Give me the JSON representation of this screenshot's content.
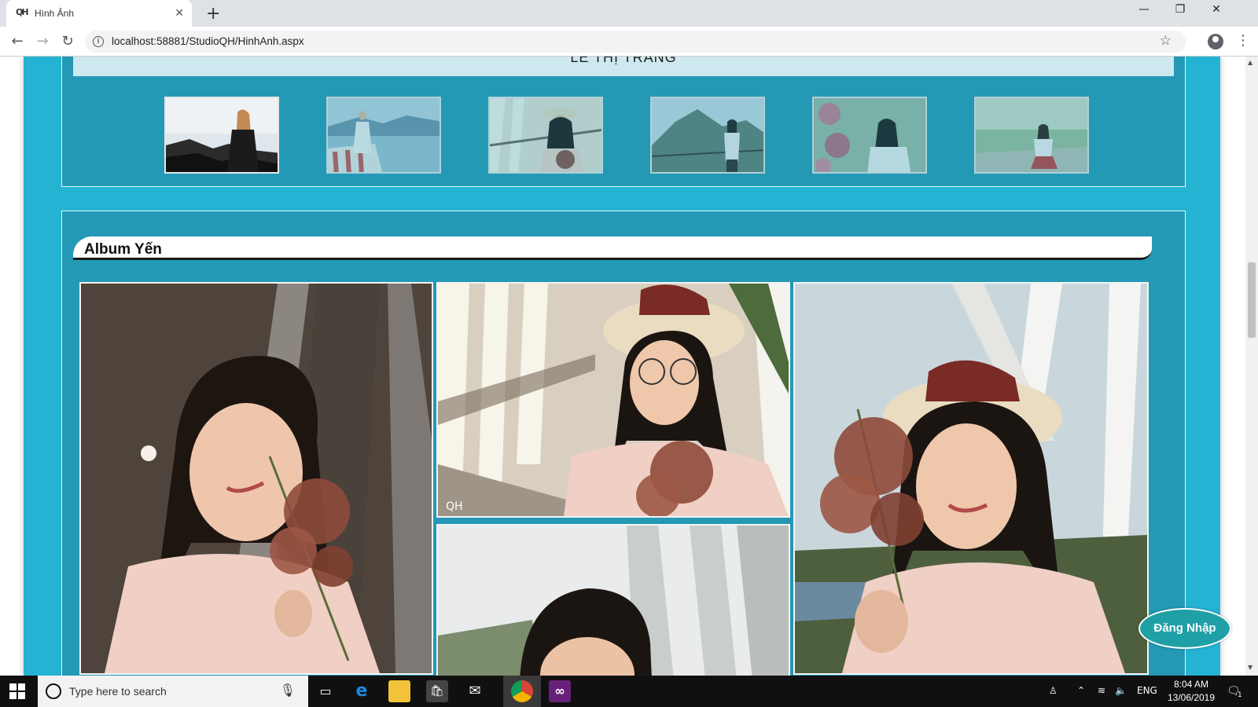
{
  "browser": {
    "tab_title": "Hình Ảnh",
    "tab_favicon": "QH",
    "close_glyph": "✕",
    "newtab_glyph": "+",
    "url": "localhost:58881/StudioQH/HinhAnh.aspx",
    "controls": {
      "minimize": "—",
      "restore": "❐",
      "close": "✕"
    },
    "nav": {
      "back": "←",
      "forward": "→",
      "reload": "↻"
    },
    "star_glyph": "☆",
    "menu_glyph": "⋮"
  },
  "page": {
    "top_section": {
      "name_label": "LÊ THỊ TRANG",
      "thumbnails": [
        {
          "name": "thumb-1",
          "dim": false
        },
        {
          "name": "thumb-2",
          "dim": true
        },
        {
          "name": "thumb-3",
          "dim": true
        },
        {
          "name": "thumb-4",
          "dim": true
        },
        {
          "name": "thumb-5",
          "dim": true
        },
        {
          "name": "thumb-6",
          "dim": true
        }
      ]
    },
    "album": {
      "title": "Album Yến",
      "photo_count_visible": 4
    },
    "login_button": "Đăng Nhập"
  },
  "taskbar": {
    "search_placeholder": "Type here to search",
    "language": "ENG",
    "time": "8:04 AM",
    "date": "13/06/2019",
    "notification_count": "1"
  },
  "colors": {
    "page_bg": "#25b3d3",
    "section_bg": "#2399b5",
    "login_bg": "#1fa0a6"
  }
}
